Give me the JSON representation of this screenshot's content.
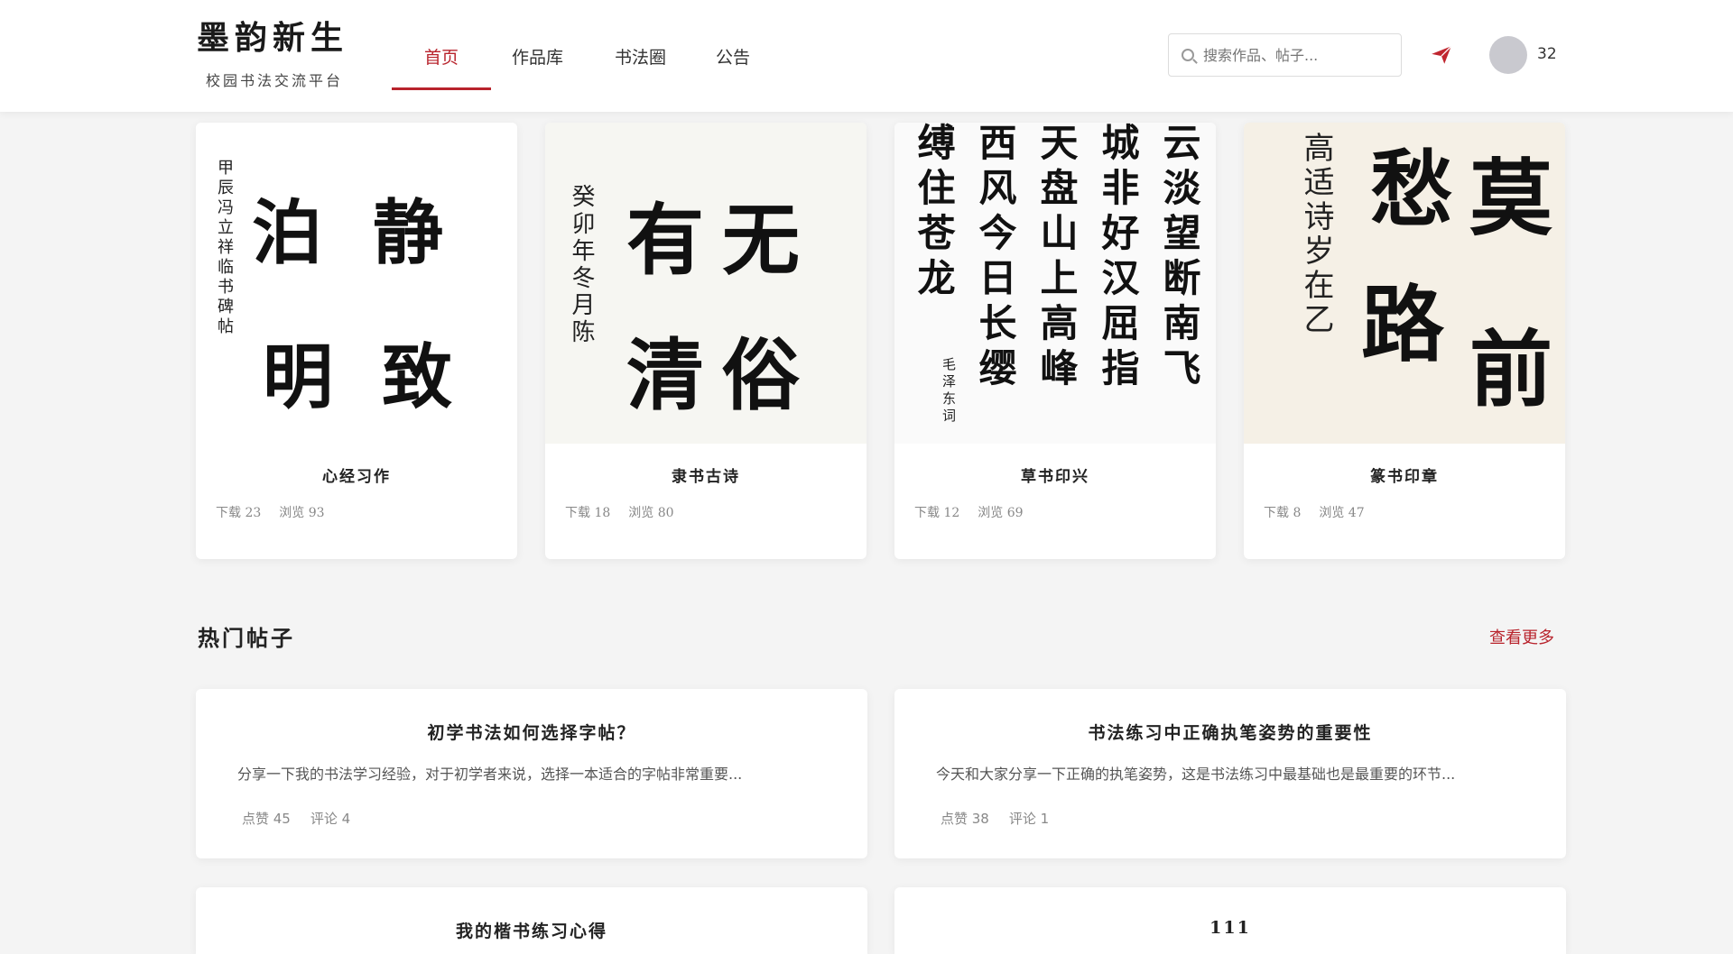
{
  "brand": {
    "title": "墨韵新生",
    "subtitle": "校园书法交流平台"
  },
  "nav": {
    "items": [
      {
        "label": "首页",
        "active": true
      },
      {
        "label": "作品库",
        "active": false
      },
      {
        "label": "书法圈",
        "active": false
      },
      {
        "label": "公告",
        "active": false
      }
    ]
  },
  "search": {
    "placeholder": "搜索作品、帖子..."
  },
  "user": {
    "count": "32"
  },
  "works": [
    {
      "title": "心经习作",
      "downloads": "下载 23",
      "views": "浏览 93",
      "main_chars": [
        "静",
        "泊",
        "致",
        "明"
      ],
      "side_text": "甲辰冯立祥临书碑帖"
    },
    {
      "title": "隶书古诗",
      "downloads": "下载 18",
      "views": "浏览 80",
      "main_chars": [
        "无",
        "有",
        "俗",
        "清"
      ],
      "side_text": "癸卯年冬月陈"
    },
    {
      "title": "草书印兴",
      "downloads": "下载 12",
      "views": "浏览 69",
      "main_chars": [
        "云淡望断南飞",
        "城非好汉屈指",
        "天盘山上高峰",
        "西风今日长缨",
        "缚住苍龙"
      ],
      "side_text": "毛泽东词"
    },
    {
      "title": "篆书印章",
      "downloads": "下载 8",
      "views": "浏览 47",
      "main_chars": [
        "莫",
        "愁",
        "前",
        "路"
      ],
      "side_text": "高适诗岁在乙"
    }
  ],
  "hot_posts": {
    "title": "热门帖子",
    "more": "查看更多",
    "items": [
      {
        "title": "初学书法如何选择字帖？",
        "excerpt": "分享一下我的书法学习经验，对于初学者来说，选择一本适合的字帖非常重要...",
        "likes": "点赞 45",
        "comments": "评论 4"
      },
      {
        "title": "书法练习中正确执笔姿势的重要性",
        "excerpt": "今天和大家分享一下正确的执笔姿势，这是书法练习中最基础也是最重要的环节...",
        "likes": "点赞 38",
        "comments": "评论 1"
      },
      {
        "title": "我的楷书练习心得",
        "excerpt": "",
        "likes": "",
        "comments": ""
      },
      {
        "title": "111",
        "excerpt": "",
        "likes": "",
        "comments": ""
      }
    ]
  },
  "colors": {
    "accent": "#b8232c",
    "background": "#f4f4f4"
  }
}
